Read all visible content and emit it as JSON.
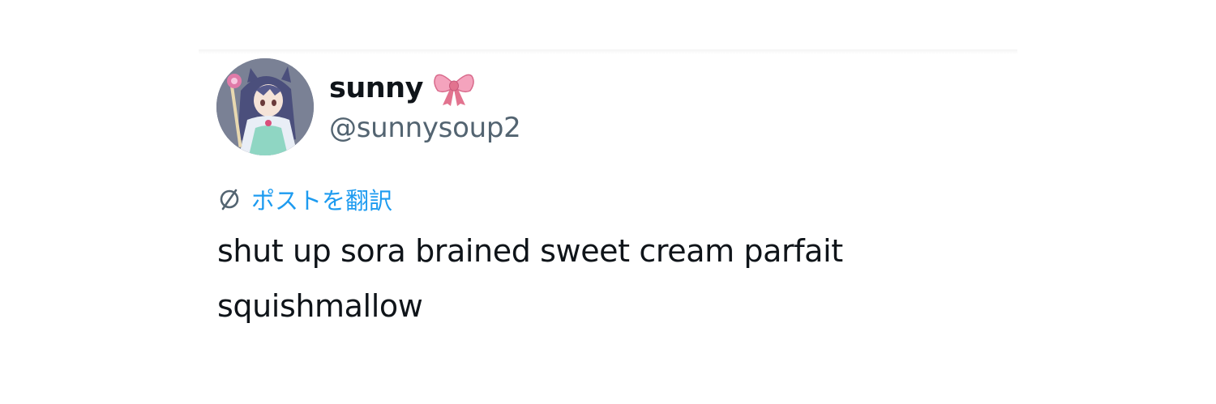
{
  "post": {
    "author": {
      "display_name": "sunny",
      "emoji": "bow-emoji",
      "handle": "@sunnysoup2",
      "avatar": "anime-character-avatar"
    },
    "translate": {
      "icon": "globe-icon",
      "label": "ポストを翻訳"
    },
    "text": "shut up sora brained sweet cream parfait squishmallow"
  },
  "colors": {
    "text_primary": "#0f1419",
    "text_secondary": "#536471",
    "link_blue": "#1d9bf0",
    "bow_pink": "#f29bb8"
  }
}
